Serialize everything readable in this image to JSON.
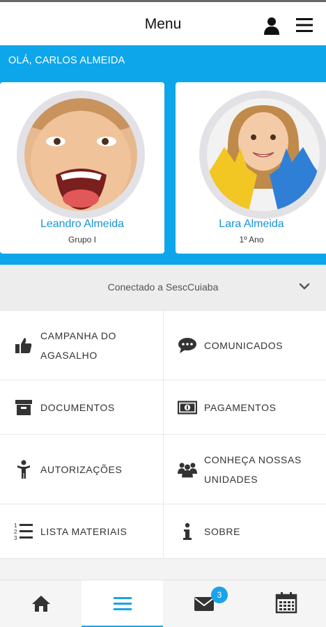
{
  "header": {
    "title": "Menu",
    "user_icon": "user-icon",
    "menu_icon": "hamburger-icon"
  },
  "greeting": "OLÁ, CARLOS ALMEIDA",
  "children": [
    {
      "name": "Leandro Almeida",
      "grade": "Grupo I",
      "photo": "boy-photo"
    },
    {
      "name": "Lara Almeida",
      "grade": "1º Ano",
      "photo": "girl-photo"
    }
  ],
  "connection": {
    "text": "Conectado a SescCuiaba",
    "chevron_icon": "chevron-down-icon"
  },
  "menu": {
    "campanha": {
      "line1": "CAMPANHA DO",
      "line2": "AGASALHO",
      "icon": "thumbs-up-icon"
    },
    "comunicados": {
      "label": "COMUNICADOS",
      "icon": "chat-bubble-icon"
    },
    "documentos": {
      "label": "DOCUMENTOS",
      "icon": "archive-box-icon"
    },
    "pagamentos": {
      "label": "PAGAMENTOS",
      "icon": "money-bill-icon"
    },
    "autorizacoes": {
      "label": "AUTORIZAÇÕES",
      "icon": "person-icon"
    },
    "unidades": {
      "line1": "CONHEÇA NOSSAS",
      "line2": "UNIDADES",
      "icon": "group-icon"
    },
    "lista": {
      "label": "LISTA MATERIAIS",
      "icon": "numbered-list-icon"
    },
    "sobre": {
      "label": "SOBRE",
      "icon": "info-icon"
    }
  },
  "bottom_nav": {
    "tabs": [
      {
        "icon": "home-icon",
        "active": false
      },
      {
        "icon": "hamburger-icon",
        "active": true
      },
      {
        "icon": "envelope-icon",
        "active": false,
        "badge": "3"
      },
      {
        "icon": "calendar-icon",
        "active": false
      }
    ]
  },
  "colors": {
    "accent": "#0EA6EA",
    "name_blue": "#1A93D3",
    "badge": "#1AA3E8"
  }
}
